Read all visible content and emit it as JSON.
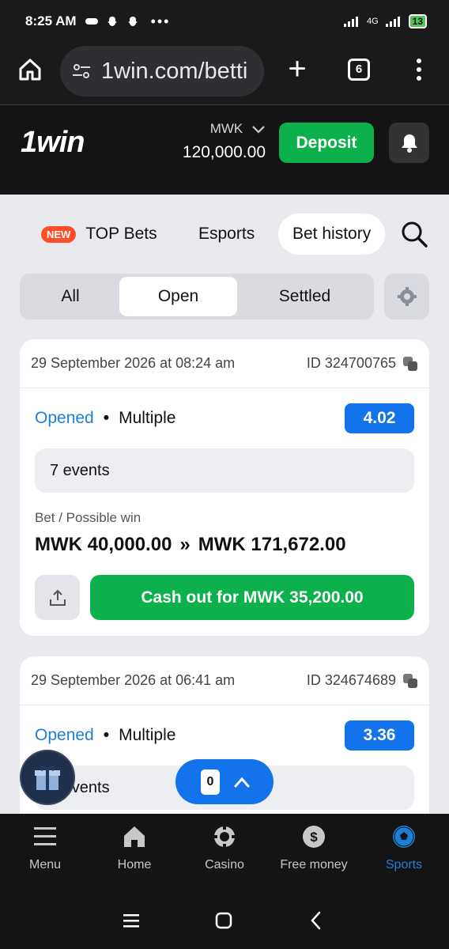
{
  "status_bar": {
    "time": "8:25 AM",
    "network": "4G",
    "battery": "13"
  },
  "browser": {
    "url": "1win.com/betti",
    "tab_count": "6"
  },
  "header": {
    "logo": "1win",
    "currency": "MWK",
    "balance": "120,000.00",
    "deposit_label": "Deposit"
  },
  "nav_tabs": {
    "new_badge": "NEW",
    "top_bets": "TOP Bets",
    "esports": "Esports",
    "bet_history": "Bet history"
  },
  "filter": {
    "all": "All",
    "open": "Open",
    "settled": "Settled",
    "selected": "Open"
  },
  "bets": [
    {
      "date": "29 September 2026 at 08:24 am",
      "id": "ID 324700765",
      "status": "Opened",
      "kind": "Multiple",
      "coefficient": "4.02",
      "events": "7 events",
      "bet_label": "Bet / Possible win",
      "stake": "MWK 40,000.00",
      "arrow": "»",
      "possible_win": "MWK 171,672.00",
      "cashout_label": "Cash out for MWK 35,200.00"
    },
    {
      "date": "29 September 2026 at 06:41 am",
      "id": "ID 324674689",
      "status": "Opened",
      "kind": "Multiple",
      "coefficient": "3.36",
      "events": "7 events"
    }
  ],
  "betslip": {
    "count": "0"
  },
  "bottom_nav": [
    {
      "label": "Menu"
    },
    {
      "label": "Home"
    },
    {
      "label": "Casino"
    },
    {
      "label": "Free money"
    },
    {
      "label": "Sports"
    }
  ],
  "colors": {
    "accent_green": "#0db14b",
    "accent_blue": "#1273eb",
    "new_badge": "#ff4d2c"
  }
}
